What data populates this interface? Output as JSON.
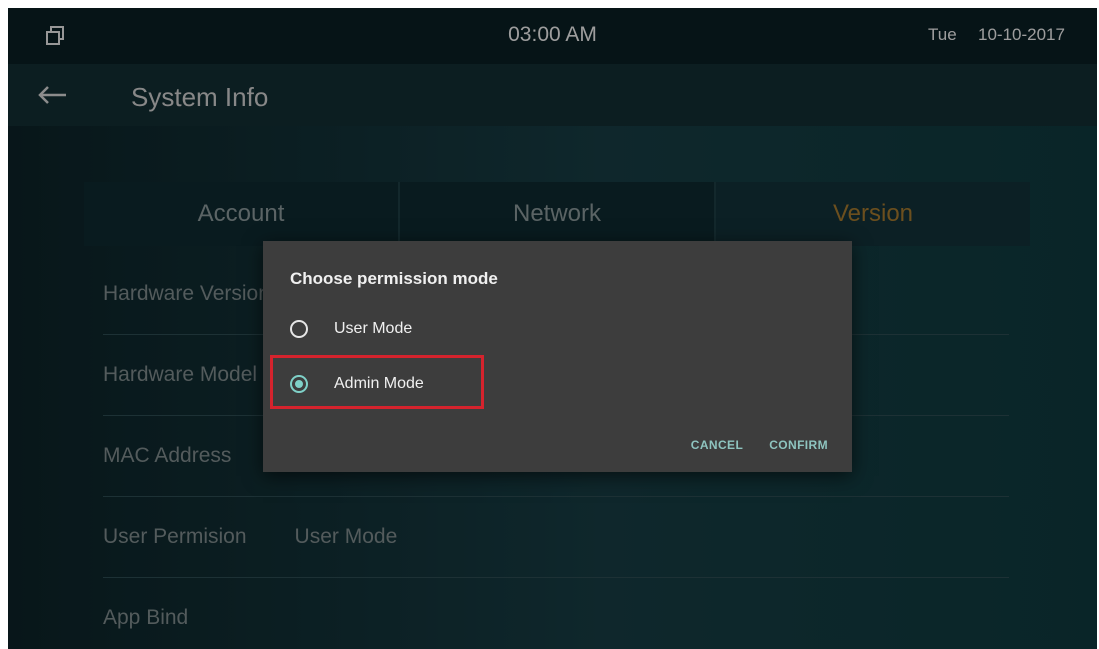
{
  "statusbar": {
    "time": "03:00 AM",
    "day": "Tue",
    "date": "10-10-2017",
    "left_icon": "window-restore-icon"
  },
  "titlebar": {
    "back_icon": "arrow-left-icon",
    "title": "System Info"
  },
  "tabs": [
    {
      "label": "Account",
      "active": false
    },
    {
      "label": "Network",
      "active": false
    },
    {
      "label": "Version",
      "active": true
    }
  ],
  "rows": [
    {
      "label": "Hardware Version",
      "value": ""
    },
    {
      "label": "Hardware Model",
      "value": ""
    },
    {
      "label": "MAC Address",
      "value": ""
    },
    {
      "label": "User Permision",
      "value": "User Mode"
    },
    {
      "label": "App Bind",
      "value": ""
    }
  ],
  "dialog": {
    "title": "Choose permission mode",
    "options": [
      {
        "label": "User Mode",
        "selected": false
      },
      {
        "label": "Admin Mode",
        "selected": true
      }
    ],
    "cancel_label": "CANCEL",
    "confirm_label": "CONFIRM"
  },
  "colors": {
    "accent_tab": "#a67a2e",
    "radio_accent": "#7fd1c8",
    "highlight": "#d5232d",
    "dialog_bg": "#3d3d3d"
  }
}
